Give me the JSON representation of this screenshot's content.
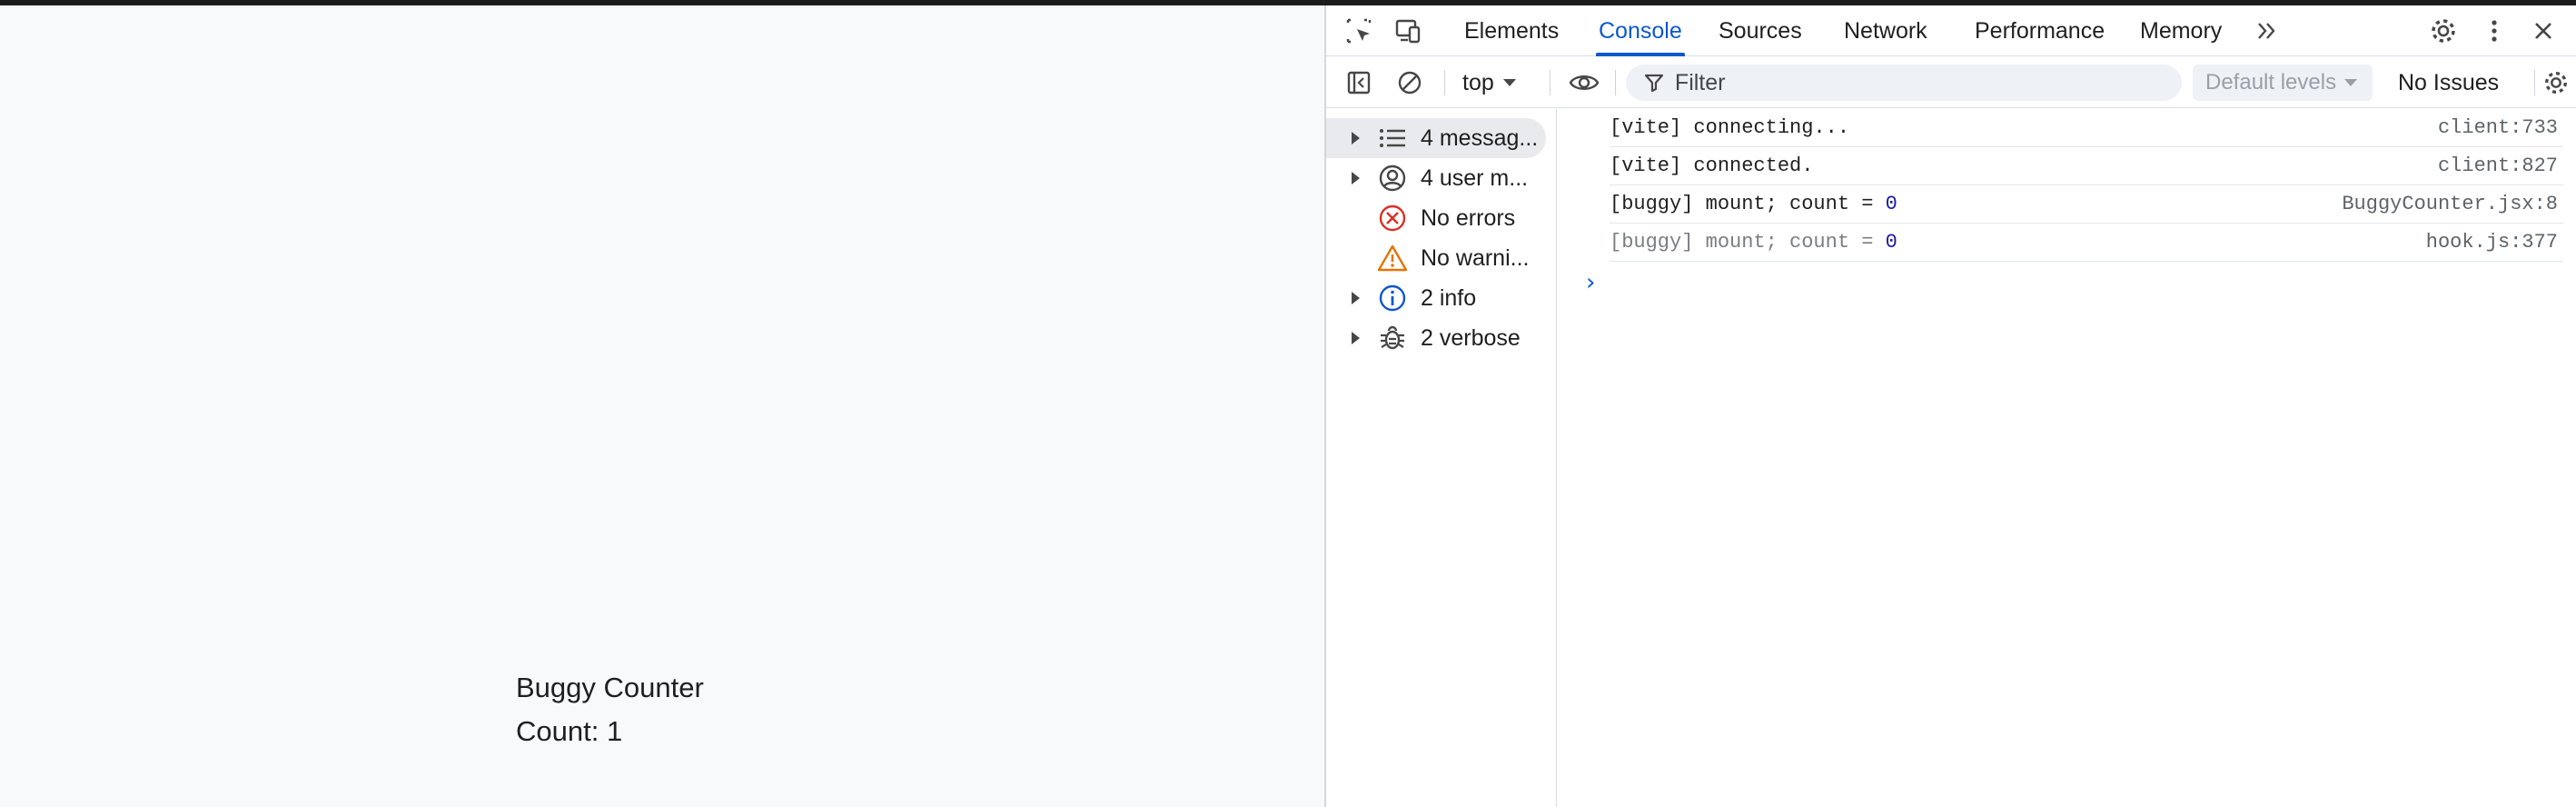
{
  "page": {
    "title": "Buggy Counter",
    "count_text": "Count: 1"
  },
  "devtools": {
    "tabs": [
      {
        "label": "Elements"
      },
      {
        "label": "Console"
      },
      {
        "label": "Sources"
      },
      {
        "label": "Network"
      },
      {
        "label": "Performance"
      },
      {
        "label": "Memory"
      }
    ],
    "active_tab": "Console",
    "toolbar": {
      "context": "top",
      "filter_placeholder": "Filter",
      "levels": "Default levels",
      "issues": "No Issues"
    },
    "sidebar": [
      {
        "label": "4 messag...",
        "icon": "list-icon",
        "expandable": true
      },
      {
        "label": "4 user m...",
        "icon": "user-icon",
        "expandable": true
      },
      {
        "label": "No errors",
        "icon": "error-icon",
        "expandable": false
      },
      {
        "label": "No warni...",
        "icon": "warning-icon",
        "expandable": false
      },
      {
        "label": "2 info",
        "icon": "info-icon",
        "expandable": true
      },
      {
        "label": "2 verbose",
        "icon": "bug-icon",
        "expandable": true
      }
    ],
    "messages": [
      {
        "text": "[vite] connecting...",
        "source": "client:733"
      },
      {
        "text": "[vite] connected.",
        "source": "client:827"
      },
      {
        "text_prefix": "[buggy] mount; count = ",
        "value": "0",
        "source": "BuggyCounter.jsx:8"
      },
      {
        "text_prefix": "[buggy] mount; count = ",
        "value": "0",
        "source": "hook.js:377"
      }
    ]
  },
  "colors": {
    "accent": "#0b57d0",
    "error": "#d93025",
    "warning": "#e37400",
    "number": "#1a1aa6"
  }
}
